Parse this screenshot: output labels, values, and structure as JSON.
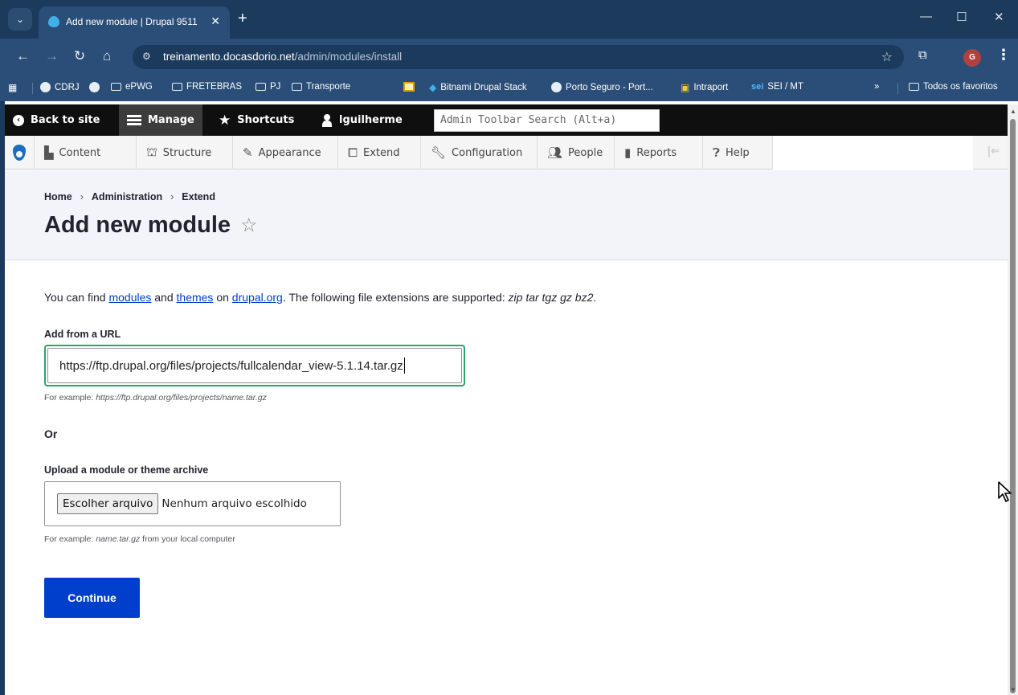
{
  "browser": {
    "tab_title": "Add new module | Drupal 9511",
    "tab_close": "✕",
    "new_tab": "+",
    "url_host": "treinamento.docasdorio.net",
    "url_path": "/admin/modules/install",
    "window_controls": {
      "minimize": "—",
      "maximize": "☐",
      "close": "✕"
    },
    "profile_initial": "G",
    "bookmarks": [
      {
        "label": "CDRJ",
        "icon": "globe-icon"
      },
      {
        "label": "",
        "icon": "globe-icon"
      },
      {
        "label": "ePWG",
        "icon": "folder-icon"
      },
      {
        "label": "FRETEBRAS",
        "icon": "folder-icon"
      },
      {
        "label": "PJ",
        "icon": "folder-icon"
      },
      {
        "label": "Transporte",
        "icon": "folder-icon"
      },
      {
        "label": "",
        "icon": "notepad-icon"
      },
      {
        "label": "Bitnami Drupal Stack",
        "icon": "drupal-icon"
      },
      {
        "label": "Porto Seguro - Port...",
        "icon": "globe-icon"
      },
      {
        "label": "Intraport",
        "icon": "building-icon"
      },
      {
        "label": "SEI / MT",
        "icon": "sei-icon"
      }
    ],
    "bookmarks_more": "»",
    "all_bookmarks": "Todos os favoritos"
  },
  "admin_toolbar": {
    "back_to_site": "Back to site",
    "manage": "Manage",
    "shortcuts": "Shortcuts",
    "user": "lguilherme",
    "search_placeholder": "Admin Toolbar Search (Alt+a)"
  },
  "admin_menu": {
    "items": [
      {
        "label": "Content",
        "icon": "content-icon"
      },
      {
        "label": "Structure",
        "icon": "structure-icon"
      },
      {
        "label": "Appearance",
        "icon": "appearance-icon"
      },
      {
        "label": "Extend",
        "icon": "extend-icon"
      },
      {
        "label": "Configuration",
        "icon": "wrench-icon"
      },
      {
        "label": "People",
        "icon": "people-icon"
      },
      {
        "label": "Reports",
        "icon": "reports-icon"
      },
      {
        "label": "Help",
        "icon": "help-icon"
      }
    ]
  },
  "header": {
    "breadcrumb": [
      "Home",
      "Administration",
      "Extend"
    ],
    "breadcrumb_sep": "›",
    "title": "Add new module",
    "favorite_star": "☆"
  },
  "content": {
    "intro_prefix": "You can find ",
    "intro_link_modules": "modules",
    "intro_and": " and ",
    "intro_link_themes": "themes",
    "intro_on": " on ",
    "intro_link_drupal": "drupal.org",
    "intro_suffix": ". The following file extensions are supported: ",
    "intro_extensions": "zip tar tgz gz bz2",
    "intro_end": ".",
    "url_label": "Add from a URL",
    "url_value": "https://ftp.drupal.org/files/projects/fullcalendar_view-5.1.14.tar.gz",
    "url_help_prefix": "For example: ",
    "url_help_example": "https://ftp.drupal.org/files/projects/name.tar.gz",
    "or_text": "Or",
    "upload_label": "Upload a module or theme archive",
    "file_button": "Escolher arquivo",
    "file_status": "Nenhum arquivo escolhido",
    "upload_help_prefix": "For example: ",
    "upload_help_example": "name.tar.gz",
    "upload_help_suffix": " from your local computer",
    "continue_label": "Continue"
  },
  "colors": {
    "accent": "#003ecc",
    "focus_green": "#26a769",
    "browser_frame": "#1b3a5c"
  }
}
